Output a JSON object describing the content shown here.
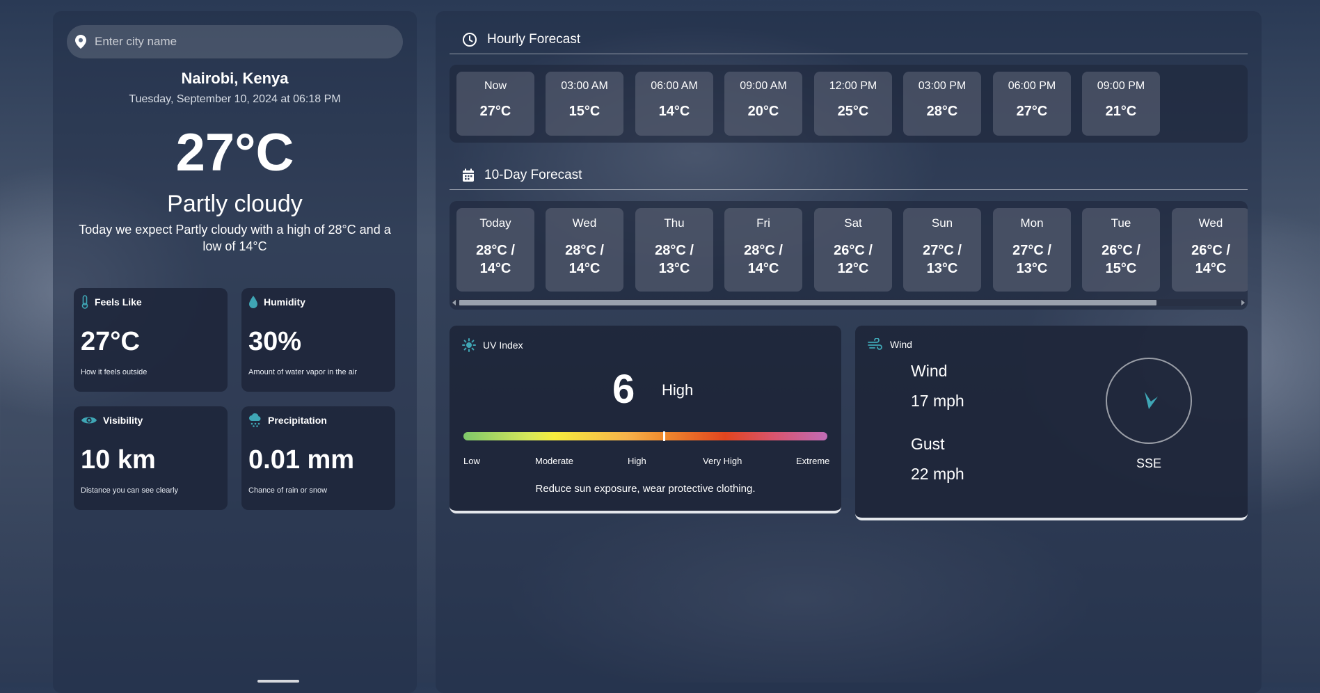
{
  "search": {
    "placeholder": "Enter city name",
    "value": ""
  },
  "location": {
    "city": "Nairobi, Kenya",
    "datetime": "Tuesday, September 10, 2024 at 06:18 PM"
  },
  "current": {
    "temperature": "27°C",
    "condition": "Partly cloudy",
    "summary": "Today we expect Partly cloudy with a high of 28°C and a low of 14°C"
  },
  "metrics": [
    {
      "title": "Feels Like",
      "value": "27°C",
      "subtitle": "How it feels outside",
      "icon": "thermometer-icon"
    },
    {
      "title": "Humidity",
      "value": "30%",
      "subtitle": "Amount of water vapor in the air",
      "icon": "droplet-icon"
    },
    {
      "title": "Visibility",
      "value": "10 km",
      "subtitle": "Distance you can see clearly",
      "icon": "eye-icon"
    },
    {
      "title": "Precipitation",
      "value": "0.01 mm",
      "subtitle": "Chance of rain or snow",
      "icon": "cloud-rain-icon"
    }
  ],
  "hourly": {
    "title": "Hourly Forecast",
    "items": [
      {
        "time": "Now",
        "temp": "27°C"
      },
      {
        "time": "03:00 AM",
        "temp": "15°C"
      },
      {
        "time": "06:00 AM",
        "temp": "14°C"
      },
      {
        "time": "09:00 AM",
        "temp": "20°C"
      },
      {
        "time": "12:00 PM",
        "temp": "25°C"
      },
      {
        "time": "03:00 PM",
        "temp": "28°C"
      },
      {
        "time": "06:00 PM",
        "temp": "27°C"
      },
      {
        "time": "09:00 PM",
        "temp": "21°C"
      }
    ]
  },
  "daily": {
    "title": "10-Day Forecast",
    "items": [
      {
        "day": "Today",
        "high": "28°C /",
        "low": "14°C"
      },
      {
        "day": "Wed",
        "high": "28°C /",
        "low": "14°C"
      },
      {
        "day": "Thu",
        "high": "28°C /",
        "low": "13°C"
      },
      {
        "day": "Fri",
        "high": "28°C /",
        "low": "14°C"
      },
      {
        "day": "Sat",
        "high": "26°C /",
        "low": "12°C"
      },
      {
        "day": "Sun",
        "high": "27°C /",
        "low": "13°C"
      },
      {
        "day": "Mon",
        "high": "27°C /",
        "low": "13°C"
      },
      {
        "day": "Tue",
        "high": "26°C /",
        "low": "15°C"
      },
      {
        "day": "Wed",
        "high": "26°C /",
        "low": "14°C"
      }
    ],
    "scroll_fraction": 0.88
  },
  "uv": {
    "title": "UV Index",
    "value": "6",
    "level": "High",
    "scale_position": 0.55,
    "scale_labels": [
      "Low",
      "Moderate",
      "High",
      "Very High",
      "Extreme"
    ],
    "advice": "Reduce sun exposure, wear protective clothing."
  },
  "wind": {
    "title": "Wind",
    "wind_label": "Wind",
    "wind_value": "17 mph",
    "gust_label": "Gust",
    "gust_value": "22 mph",
    "direction": "SSE"
  },
  "colors": {
    "accent": "#3fa6b5",
    "card": "#1e263a"
  }
}
